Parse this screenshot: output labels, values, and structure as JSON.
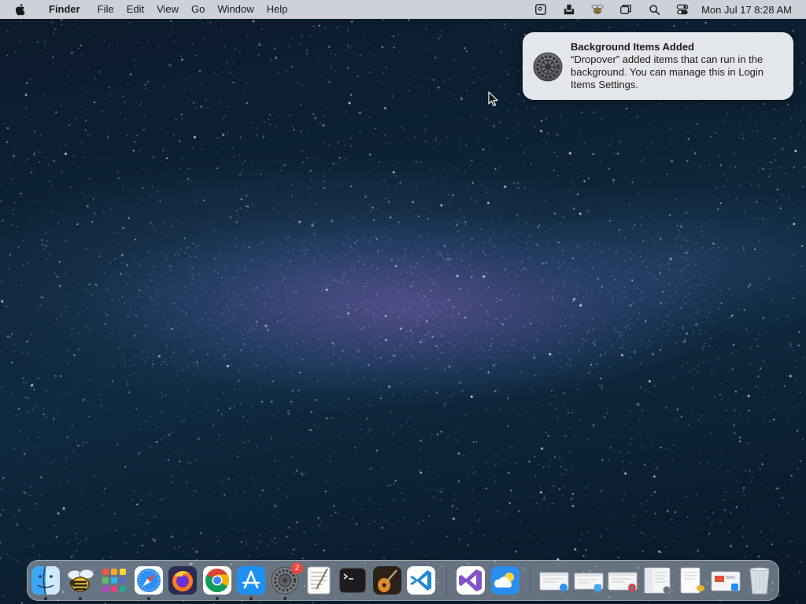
{
  "menubar": {
    "app_name": "Finder",
    "menus": [
      "File",
      "Edit",
      "View",
      "Go",
      "Window",
      "Help"
    ],
    "status_icons": [
      "screenshot-icon",
      "dropzone-icon",
      "bee-icon",
      "window-stack-icon",
      "search-icon",
      "control-center-icon"
    ],
    "clock": "Mon Jul 17  8:28 AM"
  },
  "notification": {
    "title": "Background Items Added",
    "body": "“Dropover” added items that can run in the background. You can manage this in Login Items Settings.",
    "icon": "system-settings-gear-icon"
  },
  "dock": {
    "items": [
      {
        "name": "finder",
        "running": true
      },
      {
        "name": "bee",
        "running": true
      },
      {
        "name": "launchpad",
        "running": false
      },
      {
        "name": "safari",
        "running": true
      },
      {
        "name": "firefox",
        "running": false
      },
      {
        "name": "chrome",
        "running": true
      },
      {
        "name": "app-store",
        "running": true
      },
      {
        "name": "system-settings",
        "running": true,
        "badge": "2"
      },
      {
        "name": "textedit",
        "running": false
      },
      {
        "name": "terminal",
        "running": false
      },
      {
        "name": "garageband",
        "running": false
      },
      {
        "name": "vscode",
        "running": false
      },
      {
        "name": "visual-studio",
        "running": false
      },
      {
        "name": "weather",
        "running": false
      },
      {
        "name": "minimized-safari",
        "running": false
      },
      {
        "name": "minimized-finder",
        "running": false
      },
      {
        "name": "minimized-chrome",
        "running": false
      },
      {
        "name": "minimized-settings",
        "running": false
      },
      {
        "name": "minimized-bee",
        "running": false
      },
      {
        "name": "minimized-appstore",
        "running": false
      },
      {
        "name": "trash",
        "running": false
      }
    ]
  },
  "colors": {
    "menubar_bg": "#dee2e8",
    "notification_bg": "#eceef1",
    "badge_red": "#f0453a"
  }
}
